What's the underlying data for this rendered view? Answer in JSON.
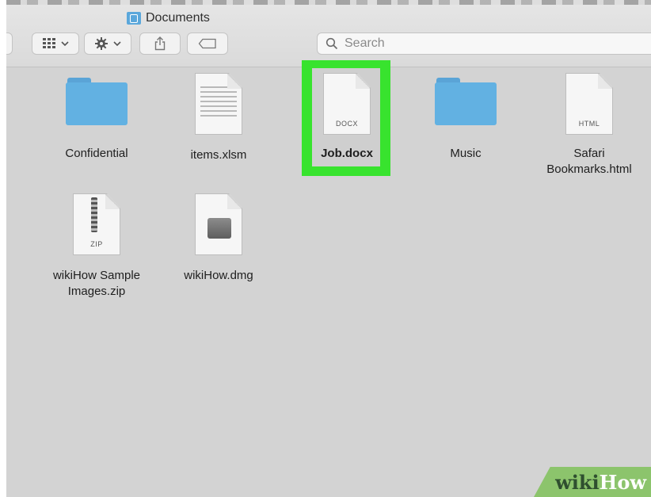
{
  "window": {
    "title": "Documents",
    "folder_icon": "folder-icon"
  },
  "toolbar": {
    "view_icon": "grid-view-icon",
    "view_chevron": "chevron-down-icon",
    "action_icon": "gear-icon",
    "action_chevron": "chevron-down-icon",
    "share_icon": "share-icon",
    "tag_icon": "tag-icon"
  },
  "search": {
    "placeholder": "Search",
    "icon": "search-icon"
  },
  "files": [
    {
      "name": "Confidential",
      "kind": "folder"
    },
    {
      "name": "items.xlsm",
      "kind": "spreadsheet"
    },
    {
      "name": "Job.docx",
      "kind": "document",
      "badge": "DOCX",
      "selected": true
    },
    {
      "name": "Music",
      "kind": "folder"
    },
    {
      "name": "Safari Bookmarks.html",
      "kind": "document",
      "badge": "HTML"
    },
    {
      "name": "wikiHow Sample Images.zip",
      "kind": "archive",
      "badge": "ZIP"
    },
    {
      "name": "wikiHow.dmg",
      "kind": "disk-image"
    }
  ],
  "colors": {
    "selection_highlight": "#38e32e",
    "folder_blue": "#62b1e2",
    "window_bg": "#d3d3d3"
  },
  "watermark": {
    "part1": "wiki",
    "part2": "How"
  }
}
